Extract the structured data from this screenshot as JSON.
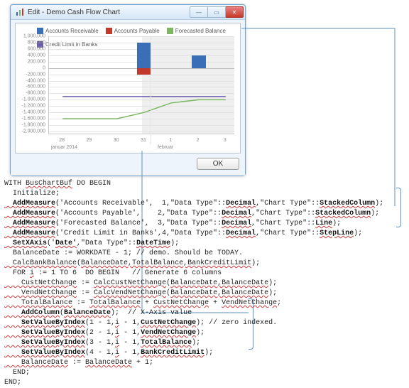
{
  "window": {
    "title": "Edit - Demo Cash Flow Chart",
    "buttons": {
      "min_label": "—",
      "max_label": "▭",
      "close_label": "✕"
    },
    "ok_label": "OK"
  },
  "legend": [
    {
      "label": "Accounts Receivable",
      "color": "#3a6fb7"
    },
    {
      "label": "Accounts Payable",
      "color": "#c0392b"
    },
    {
      "label": "Forecasted Balance",
      "color": "#7bb661"
    },
    {
      "label": "Credit Limit in Banks",
      "color": "#6b5fad"
    }
  ],
  "axes": {
    "y_ticks": [
      "1.000.000",
      "800.000",
      "600.000",
      "400.000",
      "200.000",
      "0",
      "-200.000",
      "-400.000",
      "-600.000",
      "-800.000",
      "-1.000.000",
      "-1.200.000",
      "-1.400.000",
      "-1.600.000",
      "-1.800.000",
      "-2.000.000"
    ],
    "x_ticks": [
      "28",
      "29",
      "30",
      "31",
      "1",
      "2",
      "3"
    ],
    "x_left_label": "januar 2014",
    "x_right_label": "februar"
  },
  "chart_data": {
    "type": "bar",
    "categories": [
      "28",
      "29",
      "30",
      "31",
      "1",
      "2",
      "3"
    ],
    "series": [
      {
        "name": "Accounts Receivable",
        "values": [
          0,
          0,
          0,
          800000,
          0,
          400000,
          0
        ]
      },
      {
        "name": "Accounts Payable",
        "values": [
          0,
          0,
          0,
          -200000,
          0,
          0,
          0
        ]
      },
      {
        "name": "Forecasted Balance",
        "values": [
          -1600000,
          -1600000,
          -1600000,
          -1400000,
          -1100000,
          -1000000,
          -1000000
        ]
      },
      {
        "name": "Credit Limit in Banks",
        "values": [
          -900000,
          -900000,
          -900000,
          -900000,
          -900000,
          -900000,
          -900000
        ]
      }
    ],
    "ylim": [
      -2000000,
      1000000
    ],
    "ylabel": "",
    "xlabel": "",
    "title": ""
  },
  "code": {
    "l1": "WITH ",
    "l1a": "BusChartBuf",
    "l1b": " DO BEGIN",
    "l2": "  Initialize;",
    "l3a": "  AddMeasure",
    "l3b": "('Accounts Receivable',  1,\"Data Type\"::",
    "l3c": "Decimal",
    "l3d": ",\"Chart Type\"::",
    "l3e": "StackedColumn",
    "l3f": ");",
    "l4b": "('Accounts Payable',    2,\"Data Type\"::",
    "l5b": "('Forecasted Balance',  3,\"Data Type\"::",
    "l5e": "Line",
    "l6b": "('Credit Limit in Banks',4,\"Data Type\"::",
    "l6e": "StepLine",
    "l7a": "  SetXAxis",
    "l7b": "('",
    "l7c": "Date'",
    "l7d": ",\"Data Type\"::",
    "l7e": "DateTime",
    "l7f": ");",
    "l8": "  BalanceDate := WORKDATE - 1; // demo. Should be TODAY.",
    "l9a": "  CalcBankBalance",
    "l9b": "(",
    "l9c": "BalanceDate,TotalBalance,BankCreditLimit",
    "l9d": ");",
    "l10": "  FOR ",
    "l10i": "i",
    "l10b": " := 1 TO 6  DO BEGIN   // Generate 6 columns",
    "l11a": "    CustNetChange",
    "l11b": " := ",
    "l11c": "CalcCustNetChange",
    "l11d": "(",
    "l11e": "BalanceDate,BalanceDate",
    "l11f": ");",
    "l12a": "    VendNetChange",
    "l12c": "CalcVendNetChange",
    "l13a": "    TotalBalance",
    "l13c": "TotalBalance",
    "l13d": " + ",
    "l13e": "CustNetChange",
    "l13f": " + ",
    "l13g": "VendNetChange",
    "l13h": ";",
    "l14a": "    AddColumn",
    "l14b": "(",
    "l14c": "BalanceDate",
    "l14d": ");  // X-Axis value",
    "l15a": "    SetValueByIndex",
    "l15b": "(1 - 1,",
    "l15bi": "i",
    "l15c": " - 1,",
    "l15d": "CustNetChange",
    "l15e": "); // zero indexed.",
    "l16b": "(2 - 1,",
    "l16d": "VendNetChange",
    "l16e": ");",
    "l17b": "(3 - 1,",
    "l17d": "TotalBalance",
    "l18b": "(4 - 1,",
    "l18d": "BankCreditLimit",
    "l19a": "    BalanceDate",
    "l19b": " := ",
    "l19c": "BalanceDate",
    "l19d": " + 1;",
    "l20": "  END;",
    "l21": "END;"
  }
}
